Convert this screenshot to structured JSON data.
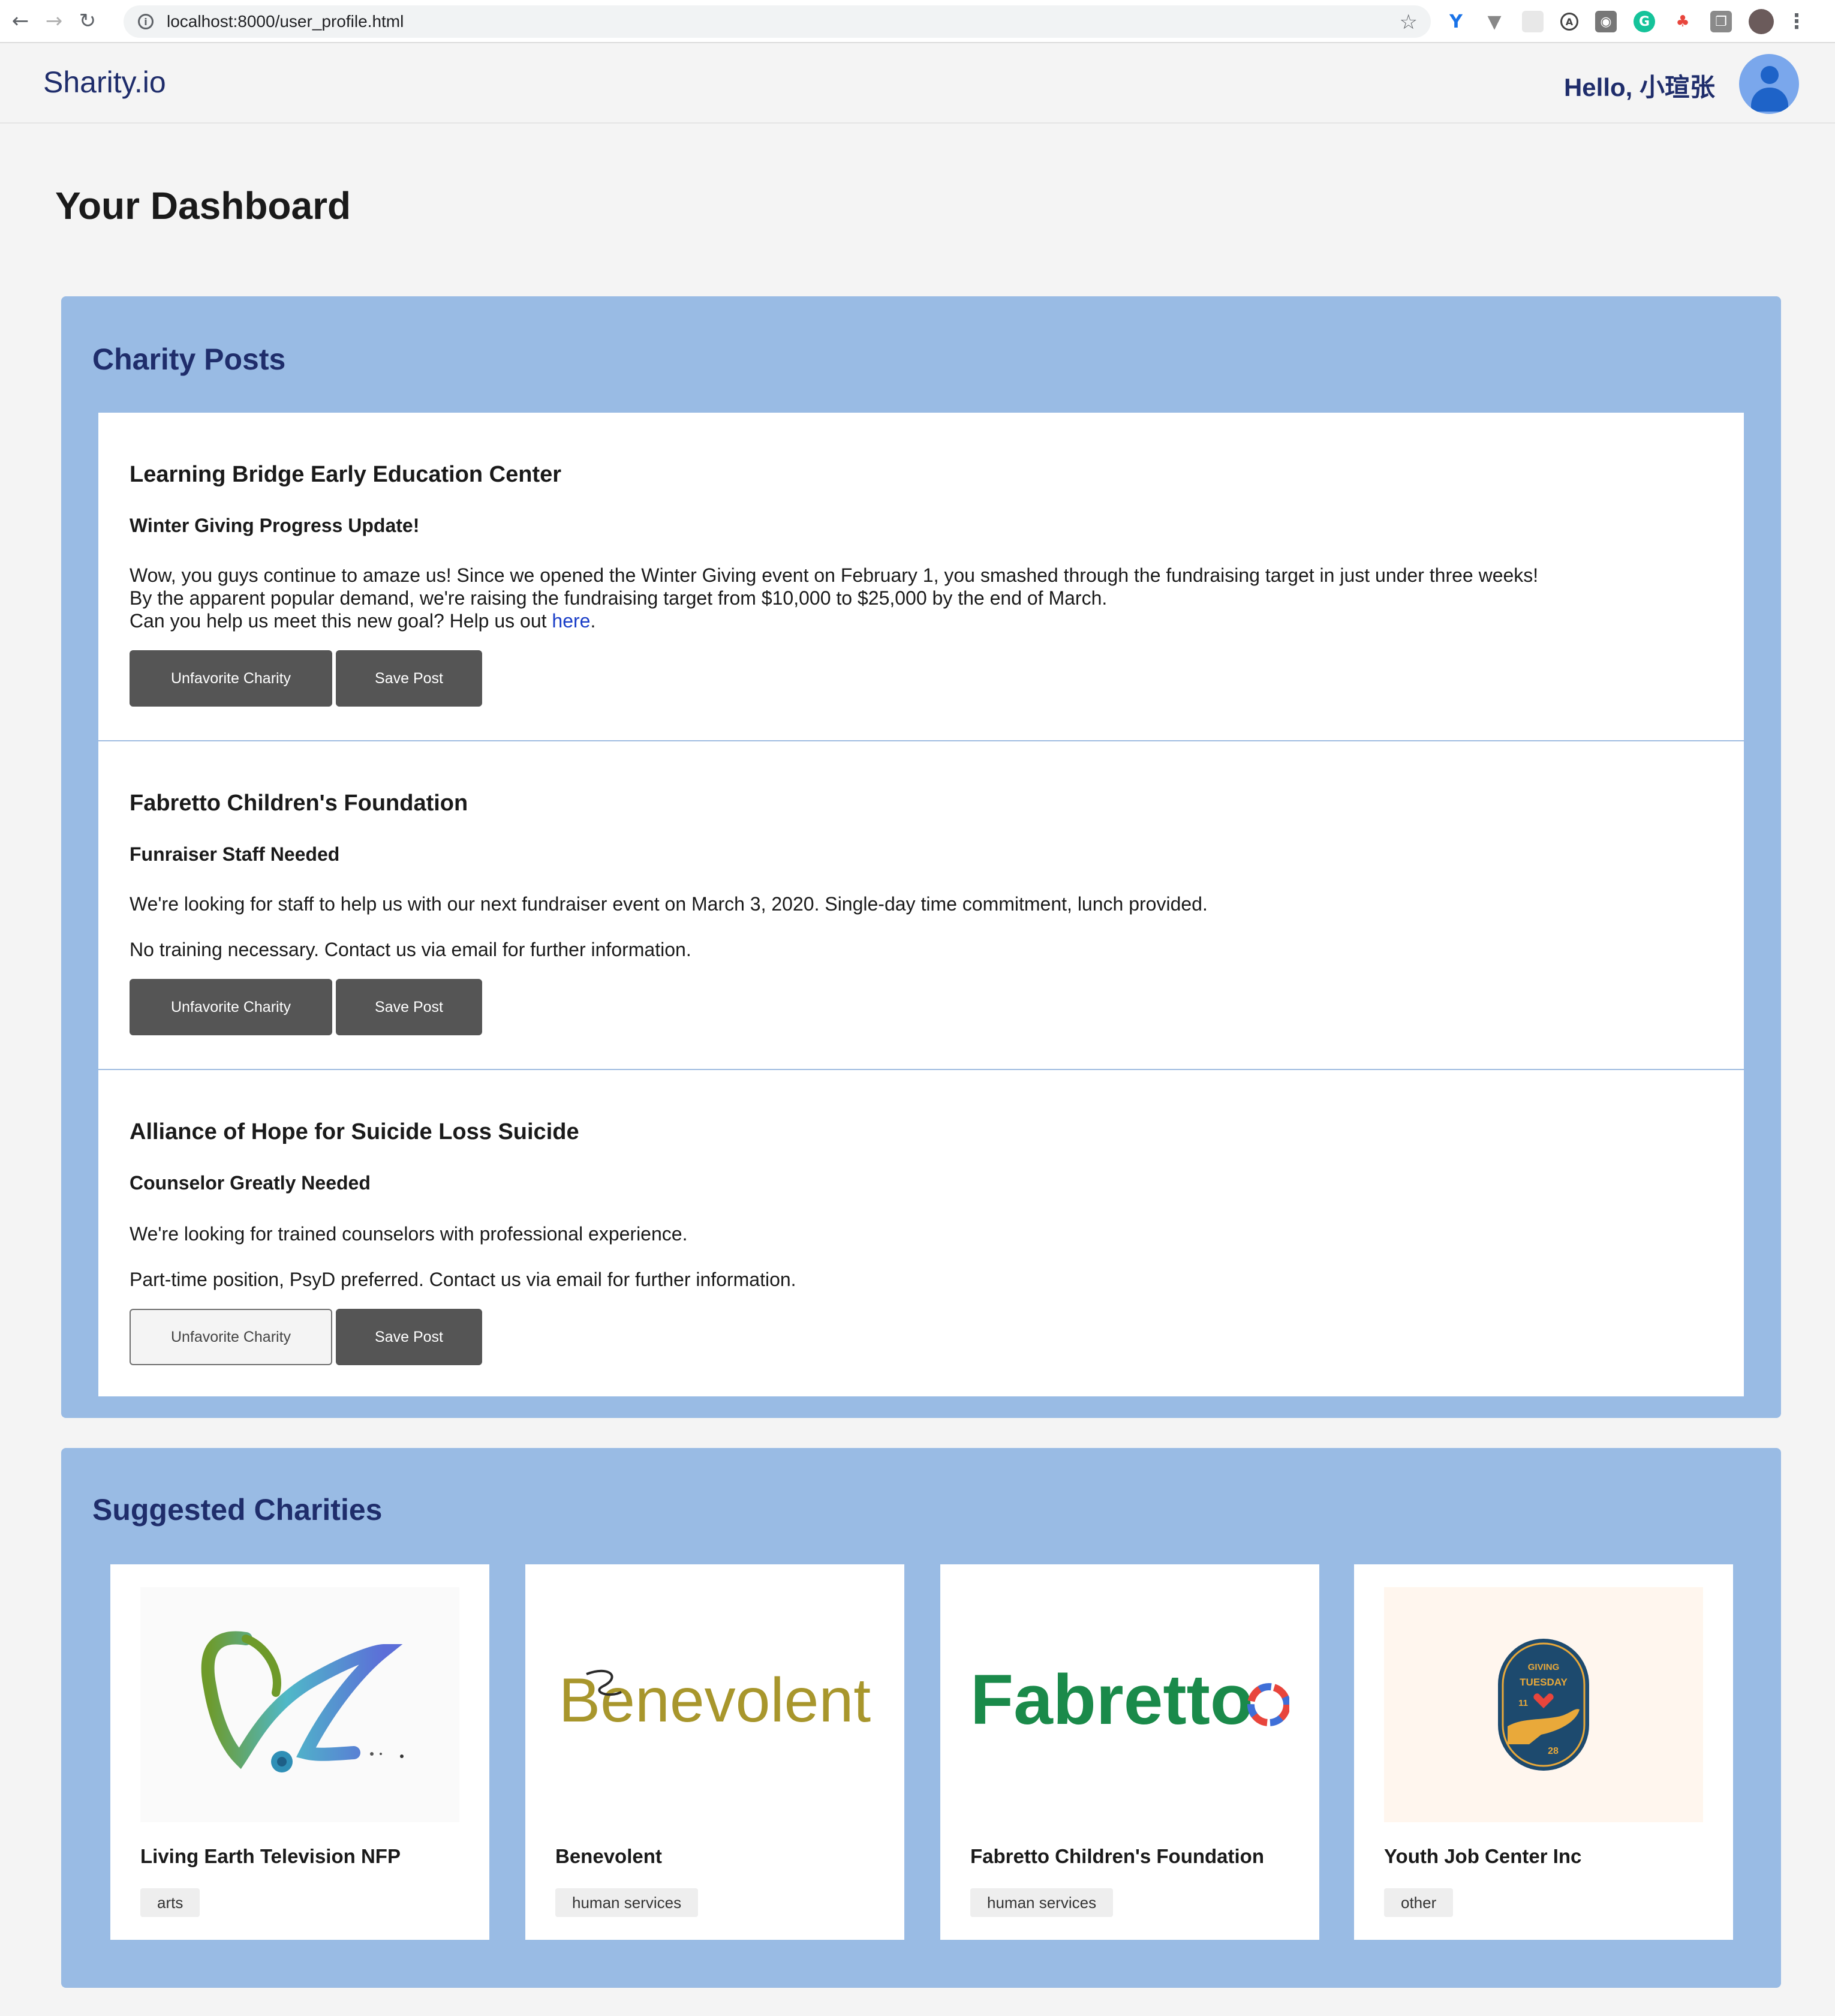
{
  "browser": {
    "url": "localhost:8000/user_profile.html"
  },
  "header": {
    "brand": "Sharity.io",
    "greeting": "Hello, 小瑄张"
  },
  "dashboard": {
    "title": "Your Dashboard"
  },
  "posts_section": {
    "title": "Charity Posts",
    "posts": [
      {
        "org": "Learning Bridge Early Education Center",
        "title": "Winter Giving Progress Update!",
        "lines": [
          "Wow, you guys continue to amaze us! Since we opened the Winter Giving event on February 1, you smashed through the fundraising target in just under three weeks!",
          "By the apparent popular demand, we're raising the fundraising target from $10,000 to $25,000 by the end of March."
        ],
        "last_line_prefix": "Can you help us meet this new goal? Help us out ",
        "link_text": "here",
        "last_line_suffix": ".",
        "unfavorite_label": "Unfavorite Charity",
        "save_label": "Save Post"
      },
      {
        "org": "Fabretto Children's Foundation",
        "title": "Funraiser Staff Needed",
        "para1": "We're looking for staff to help us with our next fundraiser event on March 3, 2020. Single-day time commitment, lunch provided.",
        "para2": "No training necessary. Contact us via email for further information.",
        "unfavorite_label": "Unfavorite Charity",
        "save_label": "Save Post"
      },
      {
        "org": "Alliance of Hope for Suicide Loss Suicide",
        "title": "Counselor Greatly Needed",
        "para1": "We're looking for trained counselors with professional experience.",
        "para2": "Part-time position, PsyD preferred. Contact us via email for further information.",
        "unfavorite_label": "Unfavorite Charity",
        "save_label": "Save Post"
      }
    ]
  },
  "suggested_section": {
    "title": "Suggested Charities",
    "charities": [
      {
        "name": "Living Earth Television NFP",
        "tag": "arts",
        "logo": "living-earth-swoosh-logo"
      },
      {
        "name": "Benevolent",
        "tag": "human services",
        "logo_text": "Benevolent"
      },
      {
        "name": "Fabretto Children's Foundation",
        "tag": "human services",
        "logo_text": "Fabretto"
      },
      {
        "name": "Youth Job Center Inc",
        "tag": "other",
        "logo_top": "GIVING",
        "logo_mid": "TUESDAY",
        "logo_left": "11",
        "logo_num": "28"
      }
    ]
  },
  "colors": {
    "panel": "#99bbe4",
    "brand": "#1f2d6b",
    "button": "#555555",
    "benevolent_gold": "#a8962c",
    "fabretto_green": "#1a8a4a"
  }
}
